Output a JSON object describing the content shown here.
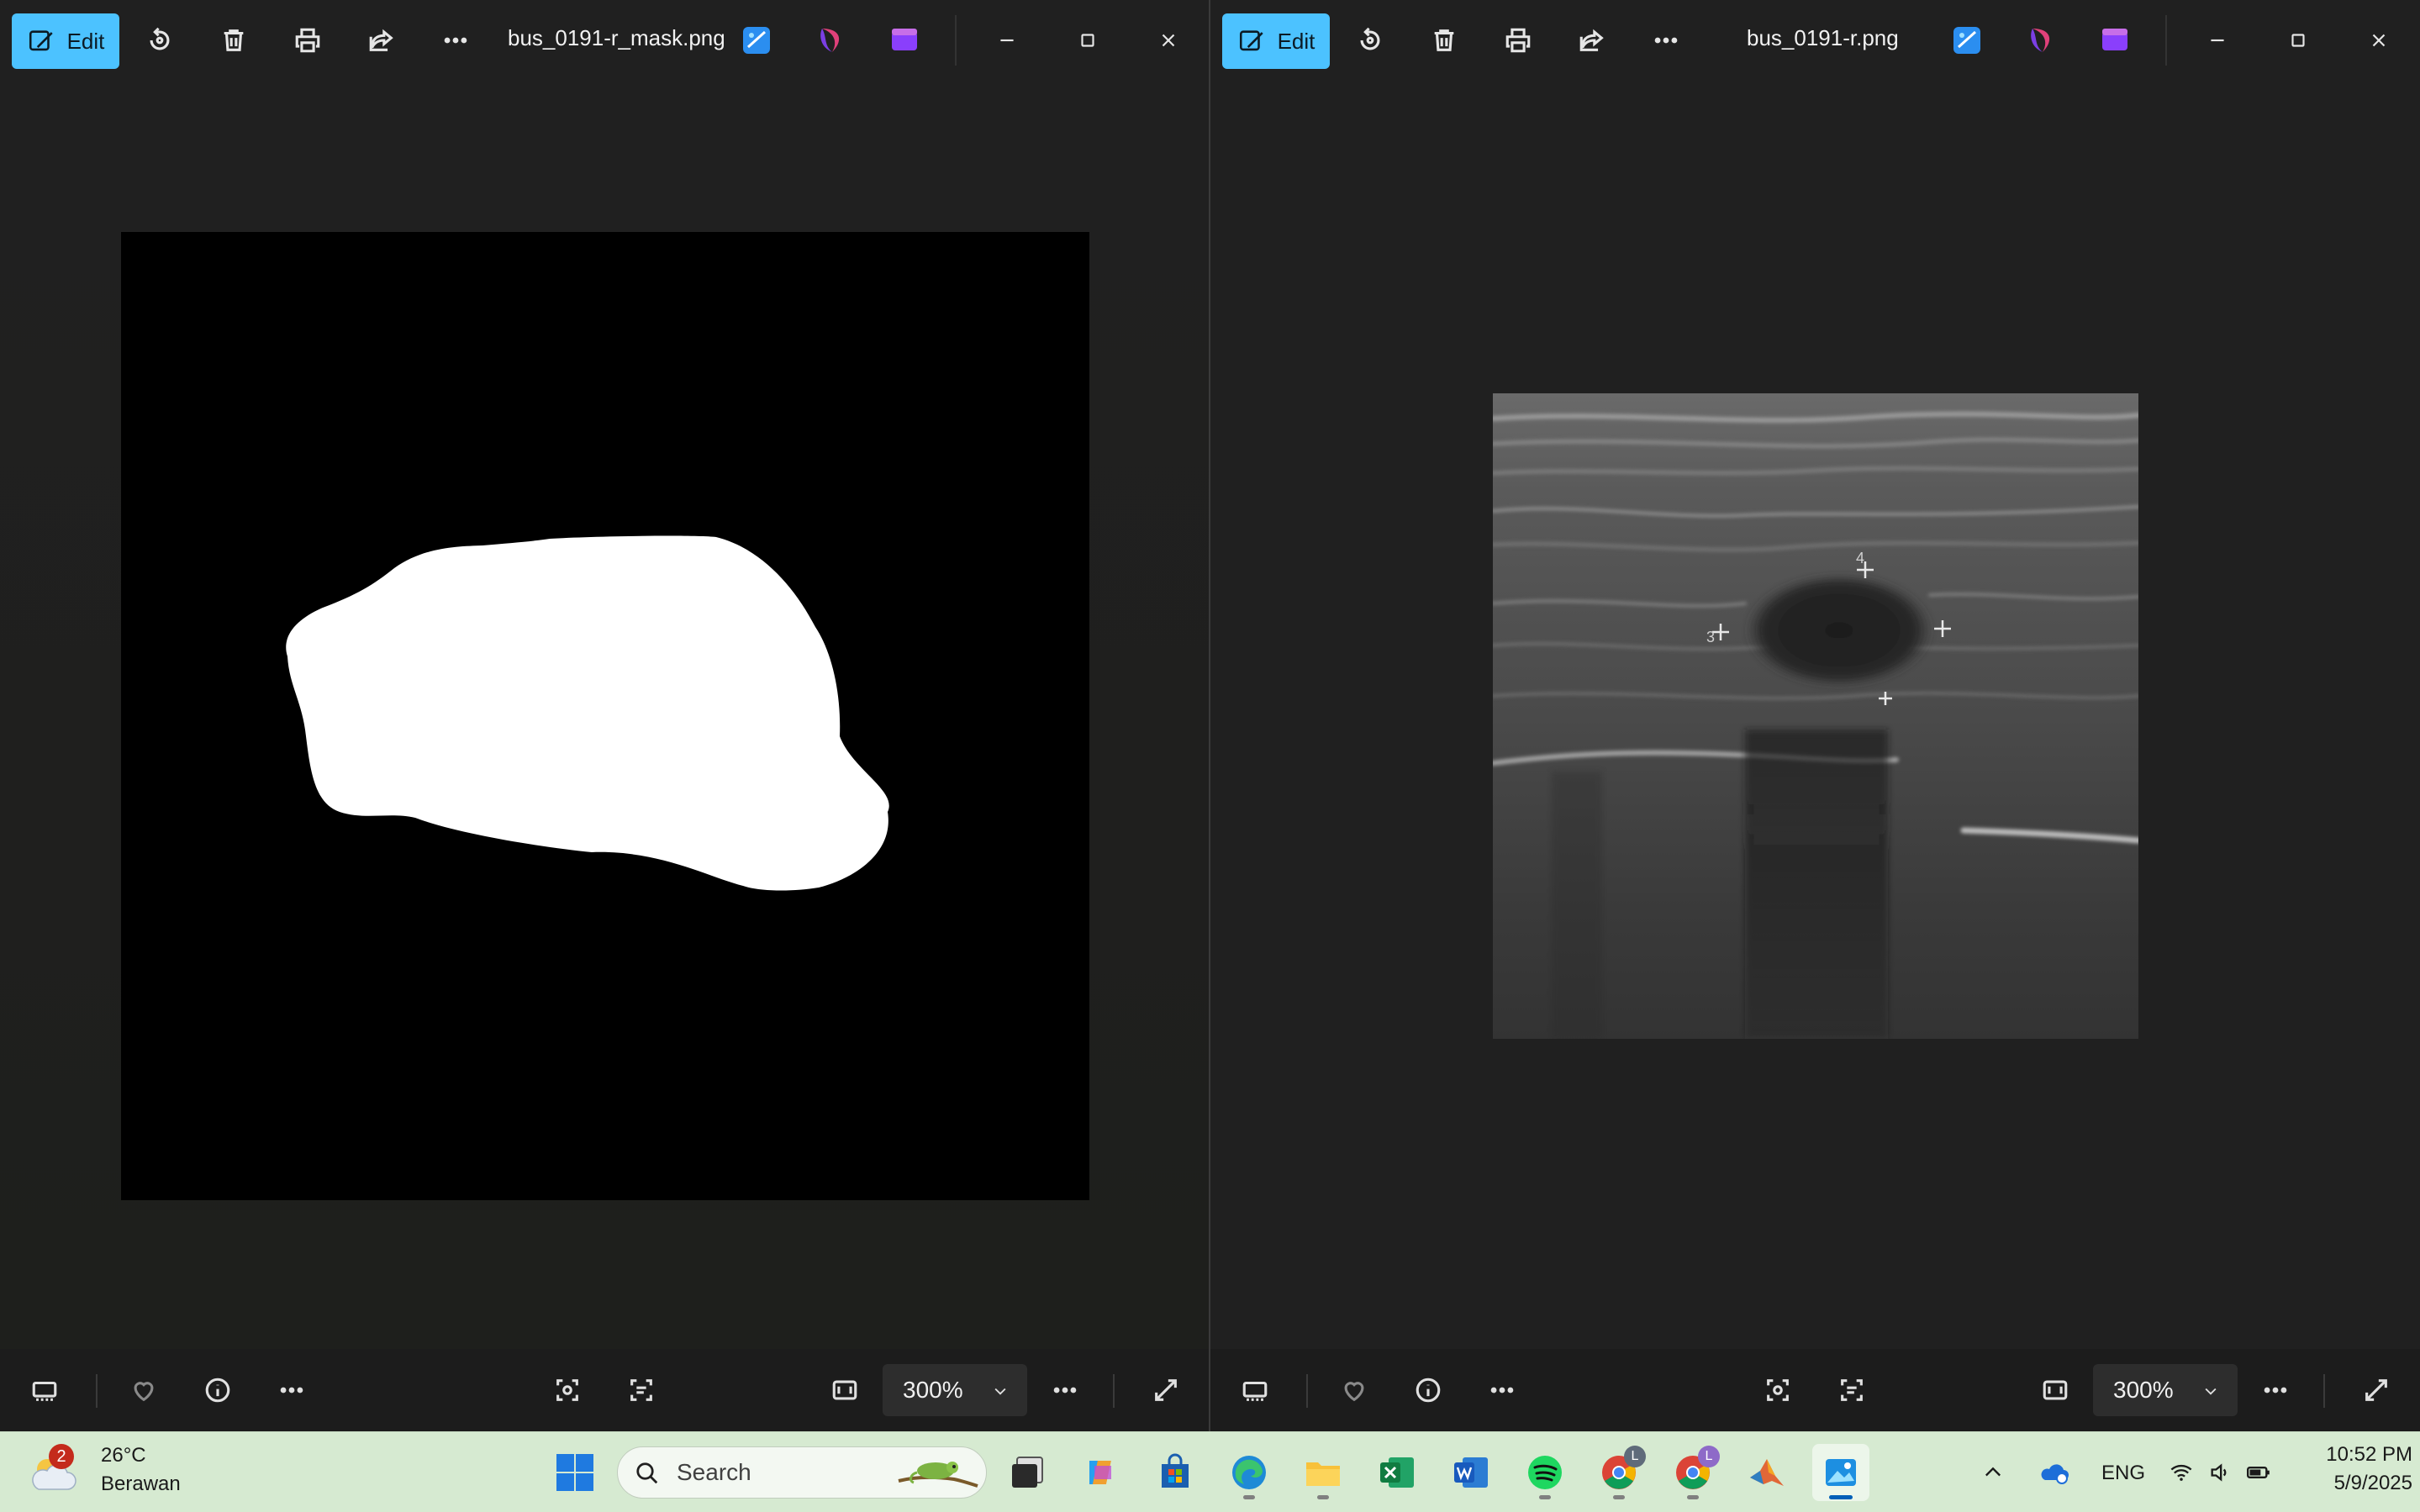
{
  "left_window": {
    "edit_label": "Edit",
    "filename": "bus_0191-r_mask.png",
    "zoom": "300%",
    "image_kind": "binary segmentation mask (white region on black)"
  },
  "right_window": {
    "edit_label": "Edit",
    "filename": "bus_0191-r.png",
    "zoom": "300%",
    "image_kind": "grayscale breast ultrasound image",
    "caliper_labels": [
      "4",
      "3"
    ]
  },
  "taskbar": {
    "weather": {
      "badge": "2",
      "temp": "26°C",
      "desc": "Berawan"
    },
    "search_placeholder": "Search",
    "apps": [
      "windows-start",
      "search",
      "task-view",
      "copilot",
      "microsoft-store",
      "edge",
      "file-explorer",
      "excel",
      "word",
      "spotify",
      "chrome-profile-1",
      "chrome-profile-2",
      "matlab",
      "photos"
    ],
    "chrome_badges": [
      "L",
      "L"
    ],
    "tray": {
      "language": "ENG",
      "time": "10:52 PM",
      "date": "5/9/2025"
    }
  },
  "colors": {
    "accent": "#4cc2ff",
    "window_bg": "#202020",
    "taskbar_bg": "#d6ead1"
  }
}
